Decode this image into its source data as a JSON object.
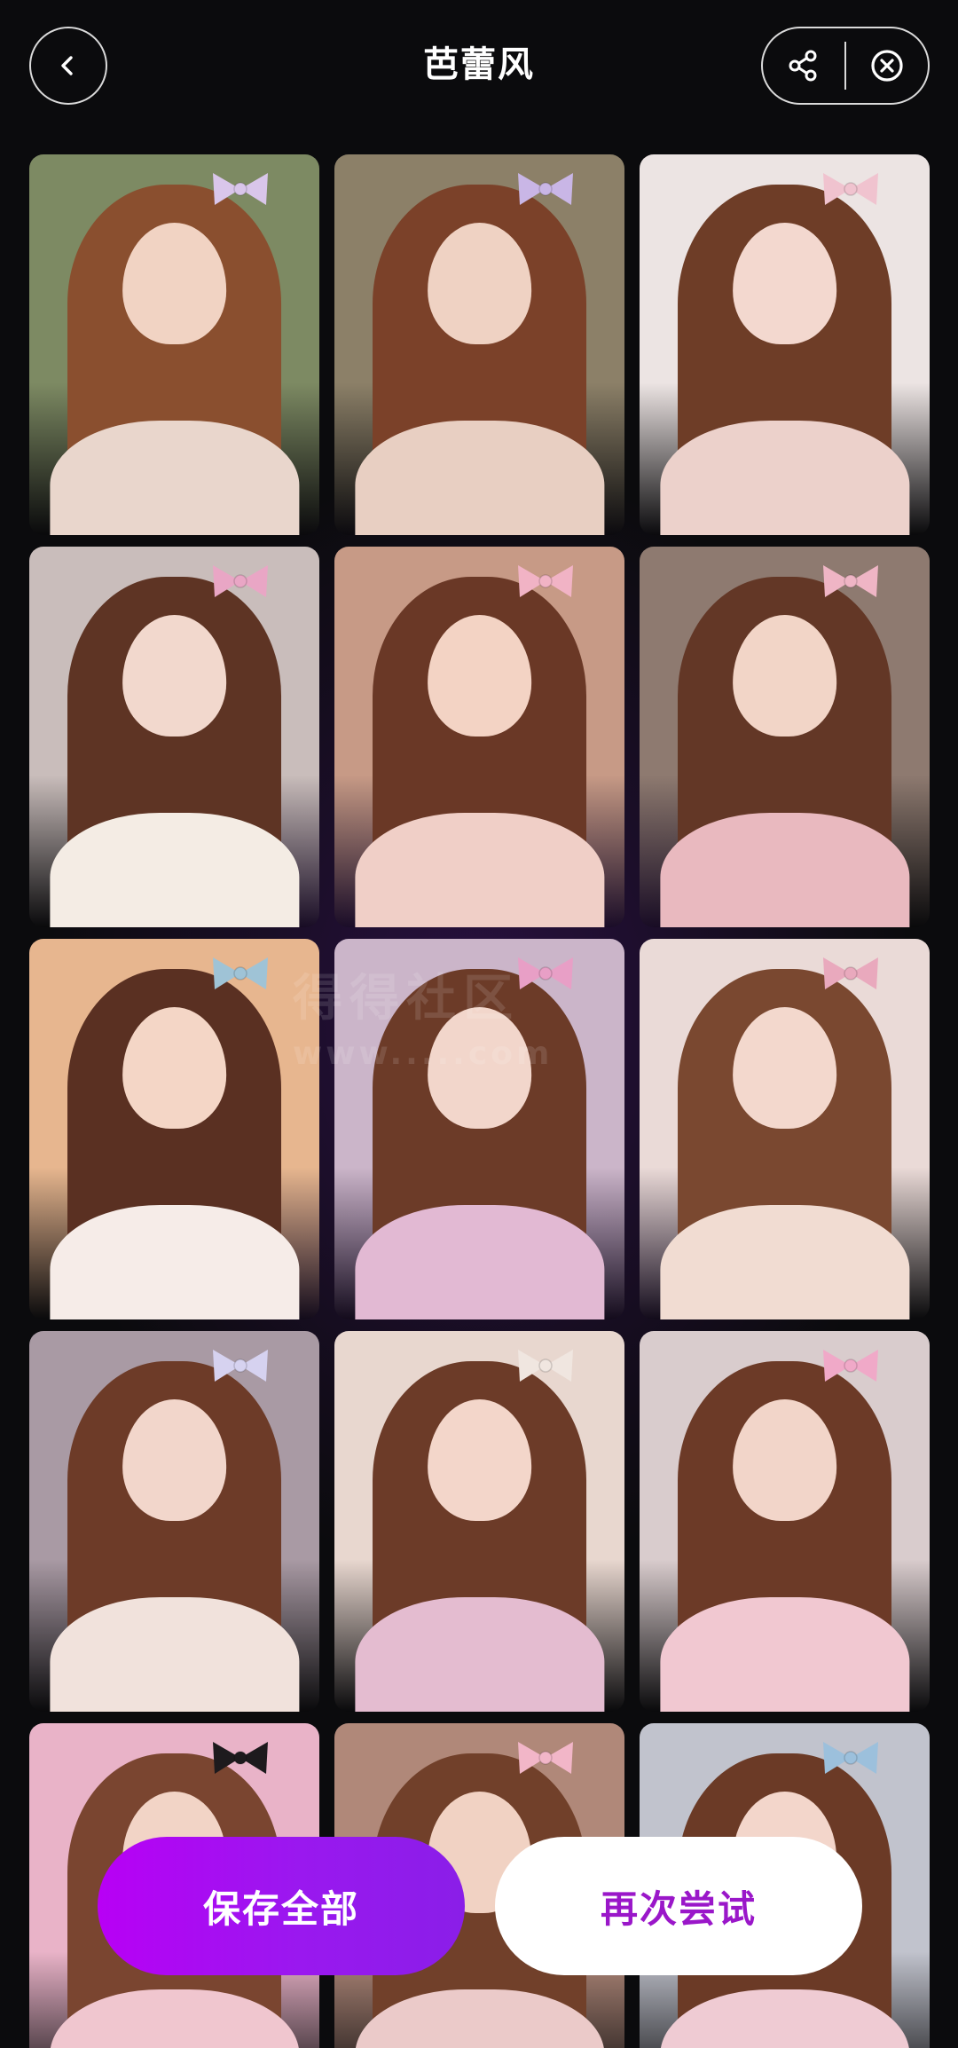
{
  "header": {
    "title": "芭蕾风",
    "back_icon": "chevron-left-icon",
    "share_icon": "share-icon",
    "close_icon": "close-circle-icon"
  },
  "watermark": {
    "line1": "得得社区",
    "line2": "www.....com"
  },
  "gallery": {
    "tiles": [
      {
        "bg": "#7d8a63",
        "hair": "#8a4f2f",
        "face": "#f1d3c3",
        "body": "#e9d6cc",
        "bow": "#d9c6ea"
      },
      {
        "bg": "#8c8068",
        "hair": "#7b4129",
        "face": "#efd2c3",
        "body": "#e8cfc2",
        "bow": "#c9b6e6"
      },
      {
        "bg": "#ece4e3",
        "hair": "#6e3d27",
        "face": "#f3d8cf",
        "body": "#ecd1cb",
        "bow": "#f0c3cf"
      },
      {
        "bg": "#c9bdbb",
        "hair": "#5e3424",
        "face": "#f2d8cd",
        "body": "#f4ece4",
        "bow": "#e9a6c5"
      },
      {
        "bg": "#c79a86",
        "hair": "#6a3826",
        "face": "#f3d3c4",
        "body": "#f0cfc7",
        "bow": "#f1b3c5"
      },
      {
        "bg": "#8e7a70",
        "hair": "#633726",
        "face": "#f2d5c7",
        "body": "#e9b9bf",
        "bow": "#efb5c5"
      },
      {
        "bg": "#e7b68f",
        "hair": "#5a3022",
        "face": "#f4d6c6",
        "body": "#f6ece8",
        "bow": "#9fc3d6"
      },
      {
        "bg": "#cbb5c9",
        "hair": "#6c3b28",
        "face": "#f2d6cb",
        "body": "#e2b9d3",
        "bow": "#e89fc6"
      },
      {
        "bg": "#eadad7",
        "hair": "#7a4830",
        "face": "#f3d8cd",
        "body": "#f1dcd2",
        "bow": "#e9a9bd"
      },
      {
        "bg": "#a99aa4",
        "hair": "#6d3b28",
        "face": "#f2d6cb",
        "body": "#f1e2dc",
        "bow": "#d6d2f0"
      },
      {
        "bg": "#e8d7cf",
        "hair": "#6c3b28",
        "face": "#f3d6ca",
        "body": "#e4bcd0",
        "bow": "#f0e6e0"
      },
      {
        "bg": "#d9cccd",
        "hair": "#6c3a27",
        "face": "#f2d5c9",
        "body": "#f1c8d1",
        "bow": "#f0a9c8"
      },
      {
        "bg": "#e9b3c8",
        "hair": "#7a4530",
        "face": "#f2d4c6",
        "body": "#f0c6cf",
        "bow": "#1d1a1d"
      },
      {
        "bg": "#b08879",
        "hair": "#71402a",
        "face": "#f1d2c3",
        "body": "#ebcac9",
        "bow": "#f2b6c8"
      },
      {
        "bg": "#c1c3cd",
        "hair": "#6b3a26",
        "face": "#f3d6cb",
        "body": "#efcbd3",
        "bow": "#9cc0dc"
      }
    ]
  },
  "actions": {
    "save_all": "保存全部",
    "retry": "再次尝试"
  }
}
